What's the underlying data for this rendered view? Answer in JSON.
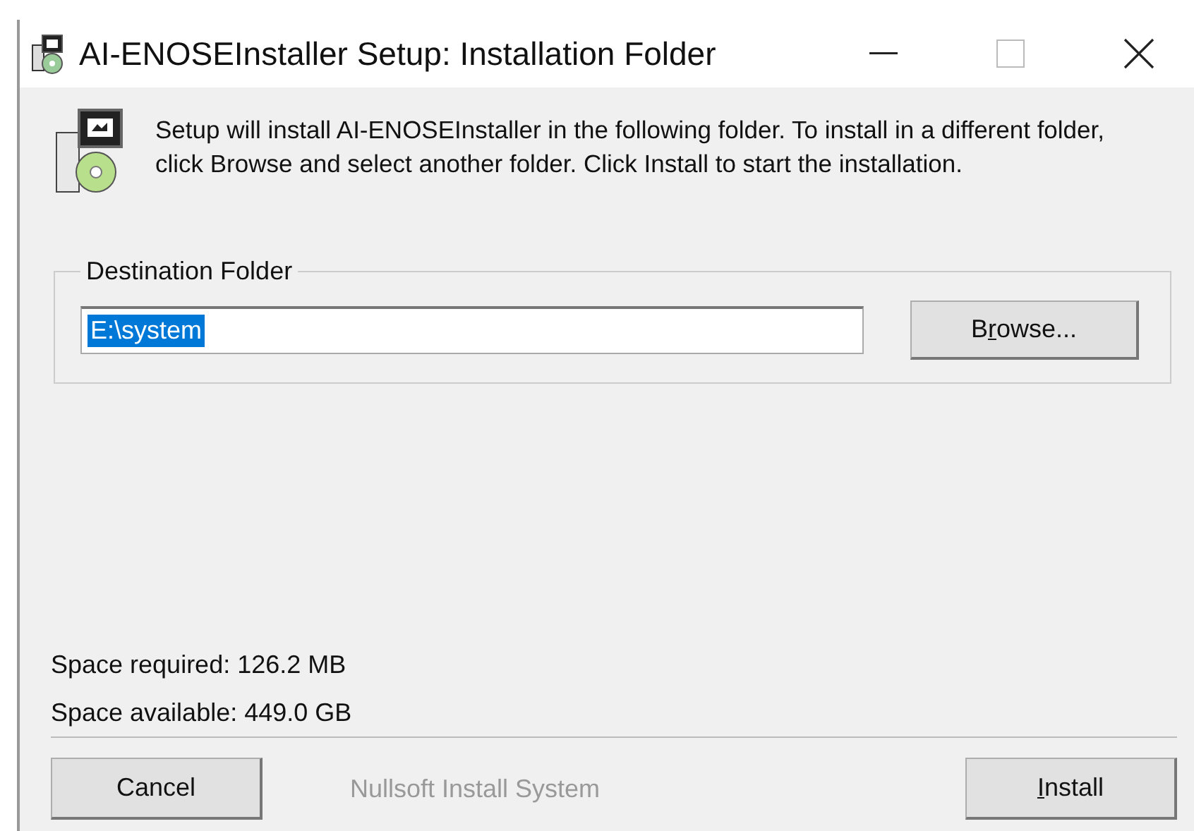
{
  "window": {
    "title": "AI-ENOSEInstaller Setup: Installation Folder"
  },
  "description": "Setup will install AI-ENOSEInstaller in the following folder. To install in a different folder, click Browse and select another folder. Click Install to start the installation.",
  "destination": {
    "label": "Destination Folder",
    "value": "E:\\system",
    "selected": true,
    "browse": {
      "label_parts": [
        {
          "text": "B",
          "underlined": false
        },
        {
          "text": "r",
          "underlined": true
        },
        {
          "text": "owse...",
          "underlined": false
        }
      ]
    }
  },
  "space_required": "Space required: 126.2 MB",
  "space_available": "Space available: 449.0 GB",
  "footer": {
    "cancel": {
      "label_parts": [
        {
          "text": "Cancel",
          "underlined": false
        }
      ]
    },
    "branding": "Nullsoft Install System",
    "install": {
      "label_parts": [
        {
          "text": "I",
          "underlined": true
        },
        {
          "text": "nstall",
          "underlined": false
        }
      ]
    }
  }
}
